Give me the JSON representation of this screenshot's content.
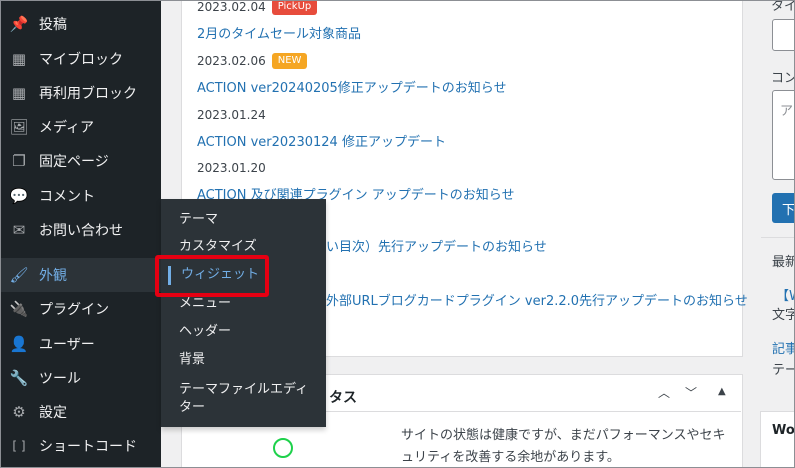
{
  "sidebar": {
    "items": [
      {
        "label": "投稿",
        "icon": "pushpin-icon",
        "glyph": "📌"
      },
      {
        "label": "マイブロック",
        "icon": "blocks-grid-icon",
        "glyph": "▦"
      },
      {
        "label": "再利用ブロック",
        "icon": "blocks-grid-icon",
        "glyph": "▦"
      },
      {
        "label": "メディア",
        "icon": "media-icon",
        "glyph": "🖼"
      },
      {
        "label": "固定ページ",
        "icon": "pages-icon",
        "glyph": "❐"
      },
      {
        "label": "コメント",
        "icon": "comment-icon",
        "glyph": "💬"
      },
      {
        "label": "お問い合わせ",
        "icon": "mail-icon",
        "glyph": "✉"
      },
      {
        "label": "外観",
        "icon": "paintbrush-icon",
        "glyph": "🖌"
      },
      {
        "label": "プラグイン",
        "icon": "plugin-icon",
        "glyph": "🔌"
      },
      {
        "label": "ユーザー",
        "icon": "user-icon",
        "glyph": "👤"
      },
      {
        "label": "ツール",
        "icon": "wrench-icon",
        "glyph": "🔧"
      },
      {
        "label": "設定",
        "icon": "settings-icon",
        "glyph": "⚙"
      },
      {
        "label": "ショートコード",
        "icon": "shortcode-icon",
        "glyph": "[ ]"
      }
    ]
  },
  "flyout": {
    "items": [
      "テーマ",
      "カスタマイズ",
      "ウィジェット",
      "メニュー",
      "ヘッダー",
      "背景",
      "テーマファイルエディ",
      "ター"
    ]
  },
  "news": [
    {
      "date": "2023.02.04",
      "badge": "PickUp",
      "title": "2月のタイムセール対象商品"
    },
    {
      "date": "2023.02.06",
      "badge": "NEW",
      "title": "ACTION ver20240205修正アップデートのお知らせ"
    },
    {
      "date": "2023.01.24",
      "badge": "",
      "title": "ACTION ver20230124 修正アップデート"
    },
    {
      "date": "2023.01.20",
      "badge": "",
      "title": "ACTION 及び関連プラグイン アップデートのお知らせ"
    },
    {
      "date": "",
      "badge": "",
      "title": "い目次）先行アップデートのお知らせ"
    },
    {
      "date": "",
      "badge": "",
      "title": "外部URLブログカードプラグイン ver2.2.0先行アップデートのお知らせ"
    }
  ],
  "status_box": {
    "title": "タス",
    "text": "サイトの状態は健康ですが、まだパフォーマンスやセキュリティを改善する余地があります。"
  },
  "right": {
    "t1": "タイ",
    "t2": "コン",
    "t3": "ア",
    "btn": "下",
    "t4": "最新",
    "l1": "【W",
    "t5": "文字",
    "l2": "記事",
    "t6": "テー",
    "t7": "Wo"
  }
}
